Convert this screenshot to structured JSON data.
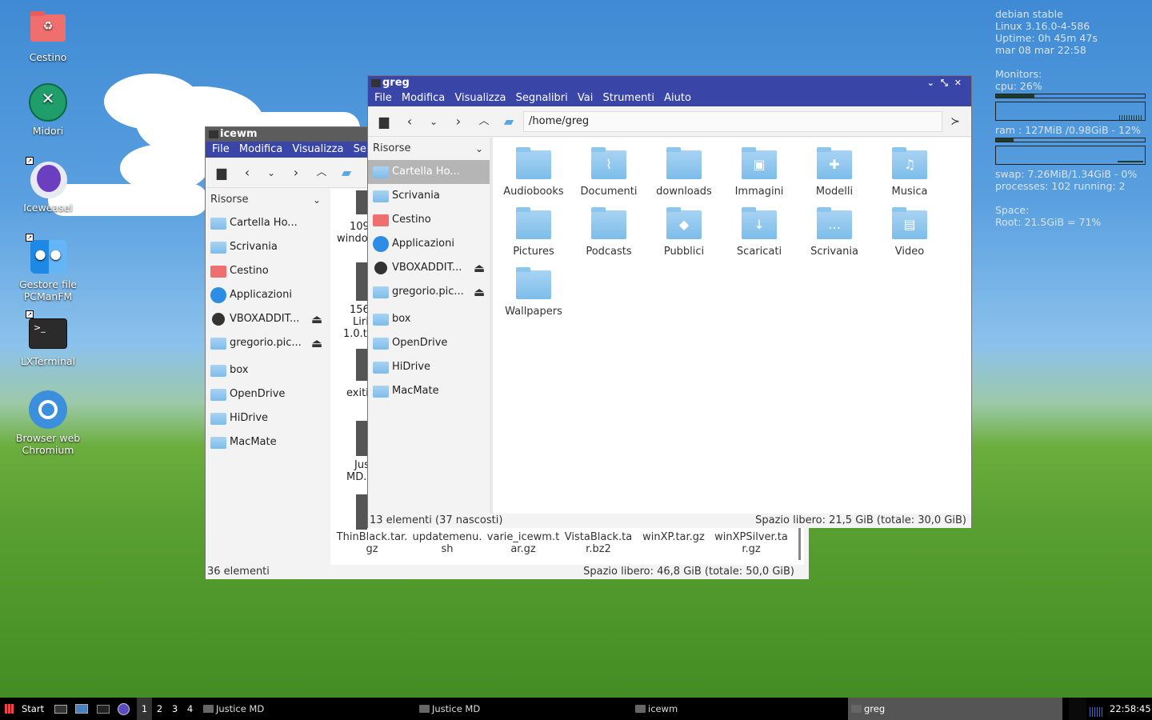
{
  "desktop": {
    "icons": [
      {
        "label": "Cestino",
        "icon": "trash-icon"
      },
      {
        "label": "Midori",
        "icon": "midori-icon"
      },
      {
        "label": "Iceweasel",
        "icon": "iceweasel-icon"
      },
      {
        "label": "Gestore file PCManFM",
        "icon": "file-manager-icon"
      },
      {
        "label": "LXTerminal",
        "icon": "terminal-icon"
      },
      {
        "label": "Browser web Chromium",
        "icon": "chromium-icon"
      }
    ]
  },
  "conky": {
    "os": "debian stable",
    "kernel": "Linux 3.16.0-4-586",
    "uptime": "Uptime: 0h 45m 47s",
    "date": "mar 08 mar 22:58",
    "monitors": "Monitors:",
    "cpu": "cpu: 26%",
    "cpu_level": 0.26,
    "ram": "ram : 127MiB /0.98GiB - 12%",
    "ram_level": 0.12,
    "swap": "swap: 7.26MiB/1.34GiB - 0%",
    "processes": "processes: 102   running: 2",
    "space": "Space:",
    "root": "Root: 21.5GiB = 71%"
  },
  "back_window": {
    "title": "icewm",
    "menu": [
      "File",
      "Modifica",
      "Visualizza",
      "Se"
    ],
    "sidebar_header": "Risorse",
    "sidebar": [
      {
        "label": "Cartella Ho...",
        "icon": "home-folder-icon"
      },
      {
        "label": "Scrivania",
        "icon": "desktop-folder-icon"
      },
      {
        "label": "Cestino",
        "icon": "trash-icon"
      },
      {
        "label": "Applicazioni",
        "icon": "applications-icon"
      },
      {
        "label": "VBOXADDIT...",
        "icon": "disc-icon"
      },
      {
        "label": "gregorio.pic...",
        "icon": "network-folder-icon"
      },
      {
        "label": "box",
        "icon": "folder-icon"
      },
      {
        "label": "OpenDrive",
        "icon": "folder-icon"
      },
      {
        "label": "HiDrive",
        "icon": "folder-icon"
      },
      {
        "label": "MacMate",
        "icon": "folder-icon"
      }
    ],
    "partial_items": [
      "109",
      "windo",
      "156",
      "Liri",
      "1.0.t",
      "exiti",
      "Jus",
      "MD.:"
    ],
    "files": [
      "ThinBlack.tar.\ngz",
      "updatemenu.\nsh",
      "varie_icewm.t\nar.gz",
      "VistaBlack.ta\nr.bz2",
      "winXP.tar.gz",
      "winXPSilver.ta\nr.gz"
    ],
    "status_left": "36 elementi",
    "status_right": "Spazio libero: 46,8 GiB (totale: 50,0 GiB)"
  },
  "front_window": {
    "title": "greg",
    "menu": [
      "File",
      "Modifica",
      "Visualizza",
      "Segnalibri",
      "Vai",
      "Strumenti",
      "Aiuto"
    ],
    "path": "/home/greg",
    "sidebar_header": "Risorse",
    "sidebar": [
      {
        "label": "Cartella Ho...",
        "icon": "home-folder-icon"
      },
      {
        "label": "Scrivania",
        "icon": "desktop-folder-icon"
      },
      {
        "label": "Cestino",
        "icon": "trash-icon"
      },
      {
        "label": "Applicazioni",
        "icon": "applications-icon"
      },
      {
        "label": "VBOXADDIT...",
        "icon": "disc-icon"
      },
      {
        "label": "gregorio.pic...",
        "icon": "network-folder-icon"
      },
      {
        "label": "box",
        "icon": "folder-icon"
      },
      {
        "label": "OpenDrive",
        "icon": "folder-icon"
      },
      {
        "label": "HiDrive",
        "icon": "folder-icon"
      },
      {
        "label": "MacMate",
        "icon": "folder-icon"
      }
    ],
    "folders": [
      {
        "label": "Audiobooks",
        "icon": "folder-icon",
        "glyph": ""
      },
      {
        "label": "Documenti",
        "icon": "documents-folder-icon",
        "glyph": "⌇"
      },
      {
        "label": "downloads",
        "icon": "folder-icon",
        "glyph": ""
      },
      {
        "label": "Immagini",
        "icon": "pictures-folder-icon",
        "glyph": "▣"
      },
      {
        "label": "Modelli",
        "icon": "templates-folder-icon",
        "glyph": "✚"
      },
      {
        "label": "Musica",
        "icon": "music-folder-icon",
        "glyph": "♫"
      },
      {
        "label": "Pictures",
        "icon": "folder-icon",
        "glyph": ""
      },
      {
        "label": "Podcasts",
        "icon": "folder-icon",
        "glyph": ""
      },
      {
        "label": "Pubblici",
        "icon": "public-folder-icon",
        "glyph": "◆"
      },
      {
        "label": "Scaricati",
        "icon": "downloads-folder-icon",
        "glyph": "↓"
      },
      {
        "label": "Scrivania",
        "icon": "desktop-folder-icon",
        "glyph": "…"
      },
      {
        "label": "Video",
        "icon": "videos-folder-icon",
        "glyph": "▤"
      },
      {
        "label": "Wallpapers",
        "icon": "folder-icon",
        "glyph": ""
      }
    ],
    "status_left": "13 elementi (37 nascosti)",
    "status_right": "Spazio libero: 21,5 GiB (totale: 30,0 GiB)"
  },
  "taskbar": {
    "start": "Start",
    "workspaces": [
      "1",
      "2",
      "3",
      "4"
    ],
    "tasks": [
      "Justice MD",
      "Justice MD",
      "icewm",
      "greg"
    ],
    "clock": "22:58:45"
  },
  "colors": {
    "titlebar": "#3a45a8",
    "menubar": "#3a45a8",
    "taskbar": "#000000"
  }
}
